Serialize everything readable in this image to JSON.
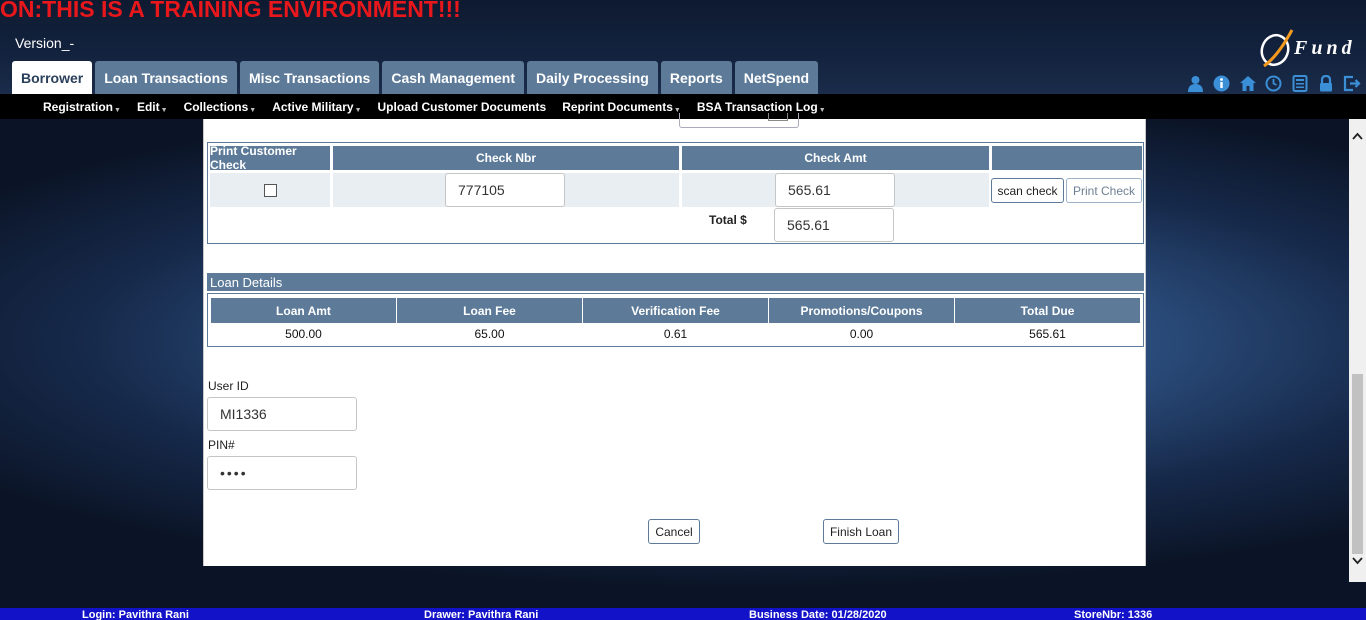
{
  "banner": {
    "training_text": "ON:THIS IS A TRAINING ENVIRONMENT!!!",
    "version_text": "Version_-",
    "logo_text": "Fund"
  },
  "tabs": [
    {
      "label": "Borrower",
      "active": true
    },
    {
      "label": "Loan Transactions",
      "active": false
    },
    {
      "label": "Misc Transactions",
      "active": false
    },
    {
      "label": "Cash Management",
      "active": false
    },
    {
      "label": "Daily Processing",
      "active": false
    },
    {
      "label": "Reports",
      "active": false
    },
    {
      "label": "NetSpend",
      "active": false
    }
  ],
  "header_icons": [
    "user-icon",
    "info-icon",
    "home-icon",
    "clock-icon",
    "calculator-icon",
    "lock-icon",
    "logout-icon"
  ],
  "subnav": [
    {
      "label": "Registration",
      "caret": true
    },
    {
      "label": "Edit",
      "caret": true
    },
    {
      "label": "Collections",
      "caret": true
    },
    {
      "label": "Active Military",
      "caret": true
    },
    {
      "label": "Upload Customer Documents",
      "caret": false
    },
    {
      "label": "Reprint Documents",
      "caret": true
    },
    {
      "label": "BSA Transaction Log",
      "caret": true
    }
  ],
  "check_table": {
    "headers": {
      "print_customer_check": "Print Customer Check",
      "check_nbr": "Check Nbr",
      "check_amt": "Check Amt",
      "actions": ""
    },
    "row": {
      "print_checked": false,
      "check_nbr": "777105",
      "check_amt": "565.61",
      "scan_label": "scan check",
      "print_label": "Print Check"
    },
    "total_label": "Total $",
    "total_value": "565.61"
  },
  "loan_details": {
    "title": "Loan Details",
    "headers": [
      "Loan Amt",
      "Loan Fee",
      "Verification Fee",
      "Promotions/Coupons",
      "Total Due"
    ],
    "values": [
      "500.00",
      "65.00",
      "0.61",
      "0.00",
      "565.61"
    ]
  },
  "form": {
    "user_id_label": "User ID",
    "user_id_value": "MI1336",
    "pin_label": "PIN#",
    "pin_value": "••••",
    "cancel_label": "Cancel",
    "finish_label": "Finish Loan"
  },
  "status": {
    "login": "Login: Pavithra Rani",
    "drawer": "Drawer: Pavithra Rani",
    "business_date": "Business Date: 01/28/2020",
    "store": "StoreNbr: 1336"
  },
  "colors": {
    "banner_red": "#e8171c",
    "tab_blue": "#5d7b99",
    "status_blue": "#1212c8"
  }
}
